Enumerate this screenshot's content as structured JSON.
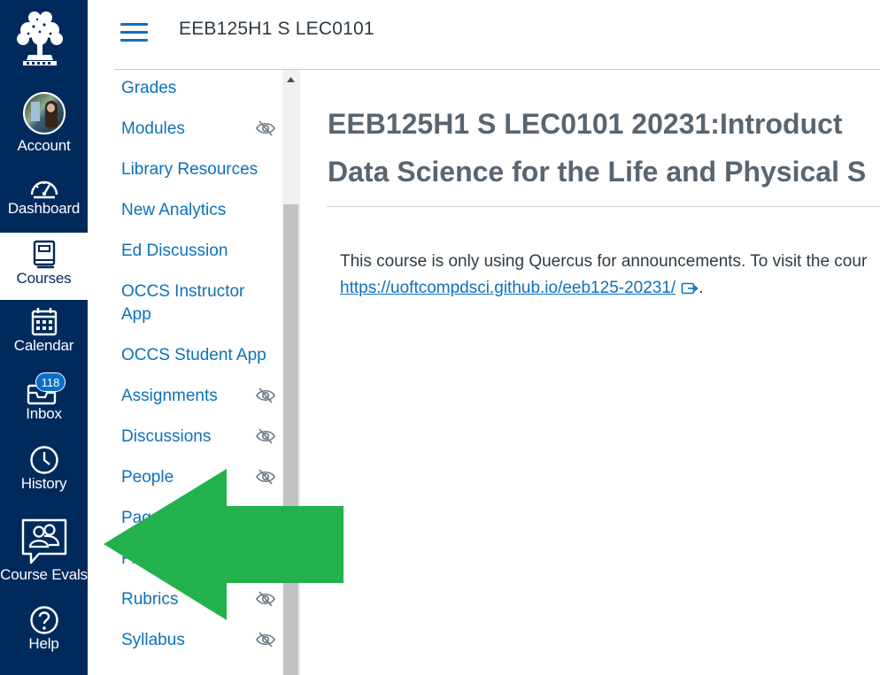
{
  "global_nav": {
    "items": [
      {
        "label": "Account",
        "icon": "avatar"
      },
      {
        "label": "Dashboard",
        "icon": "dashboard-icon"
      },
      {
        "label": "Courses",
        "icon": "courses-icon",
        "active": true
      },
      {
        "label": "Calendar",
        "icon": "calendar-icon"
      },
      {
        "label": "Inbox",
        "icon": "inbox-icon",
        "badge": "118"
      },
      {
        "label": "History",
        "icon": "clock-icon"
      },
      {
        "label": "Course Evals",
        "icon": "course-evals-icon"
      },
      {
        "label": "Help",
        "icon": "help-icon"
      }
    ],
    "colors": {
      "background": "#002a5c",
      "active_bg": "#ffffff",
      "badge": "#0770c9"
    }
  },
  "header": {
    "breadcrumb": "EEB125H1 S LEC0101"
  },
  "course_nav": {
    "items": [
      {
        "label": "Grades",
        "hidden_icon": false
      },
      {
        "label": "Modules",
        "hidden_icon": true
      },
      {
        "label": "Library Resources",
        "hidden_icon": false
      },
      {
        "label": "New Analytics",
        "hidden_icon": false
      },
      {
        "label": "Ed Discussion",
        "hidden_icon": false
      },
      {
        "label_line1": "OCCS Instructor",
        "label_line2": "App",
        "hidden_icon": false
      },
      {
        "label": "OCCS Student App",
        "hidden_icon": false
      },
      {
        "label": "Assignments",
        "hidden_icon": true
      },
      {
        "label": "Discussions",
        "hidden_icon": true
      },
      {
        "label": "People",
        "hidden_icon": true
      },
      {
        "label": "Pages",
        "hidden_icon": false
      },
      {
        "label": "Files",
        "hidden_icon": false
      },
      {
        "label": "Rubrics",
        "hidden_icon": true
      },
      {
        "label": "Syllabus",
        "hidden_icon": true
      }
    ],
    "link_color": "#0d71bb"
  },
  "main": {
    "title_line1": "EEB125H1 S LEC0101 20231:Introduct",
    "title_line2": "Data Science for the Life and Physical S",
    "body_text": "This course is only using Quercus for announcements. To visit the cour",
    "link_text": "https://uoftcompdsci.github.io/eeb125-20231/",
    "link_suffix": "."
  },
  "annotation": {
    "color": "#22b14c",
    "direction": "left"
  }
}
